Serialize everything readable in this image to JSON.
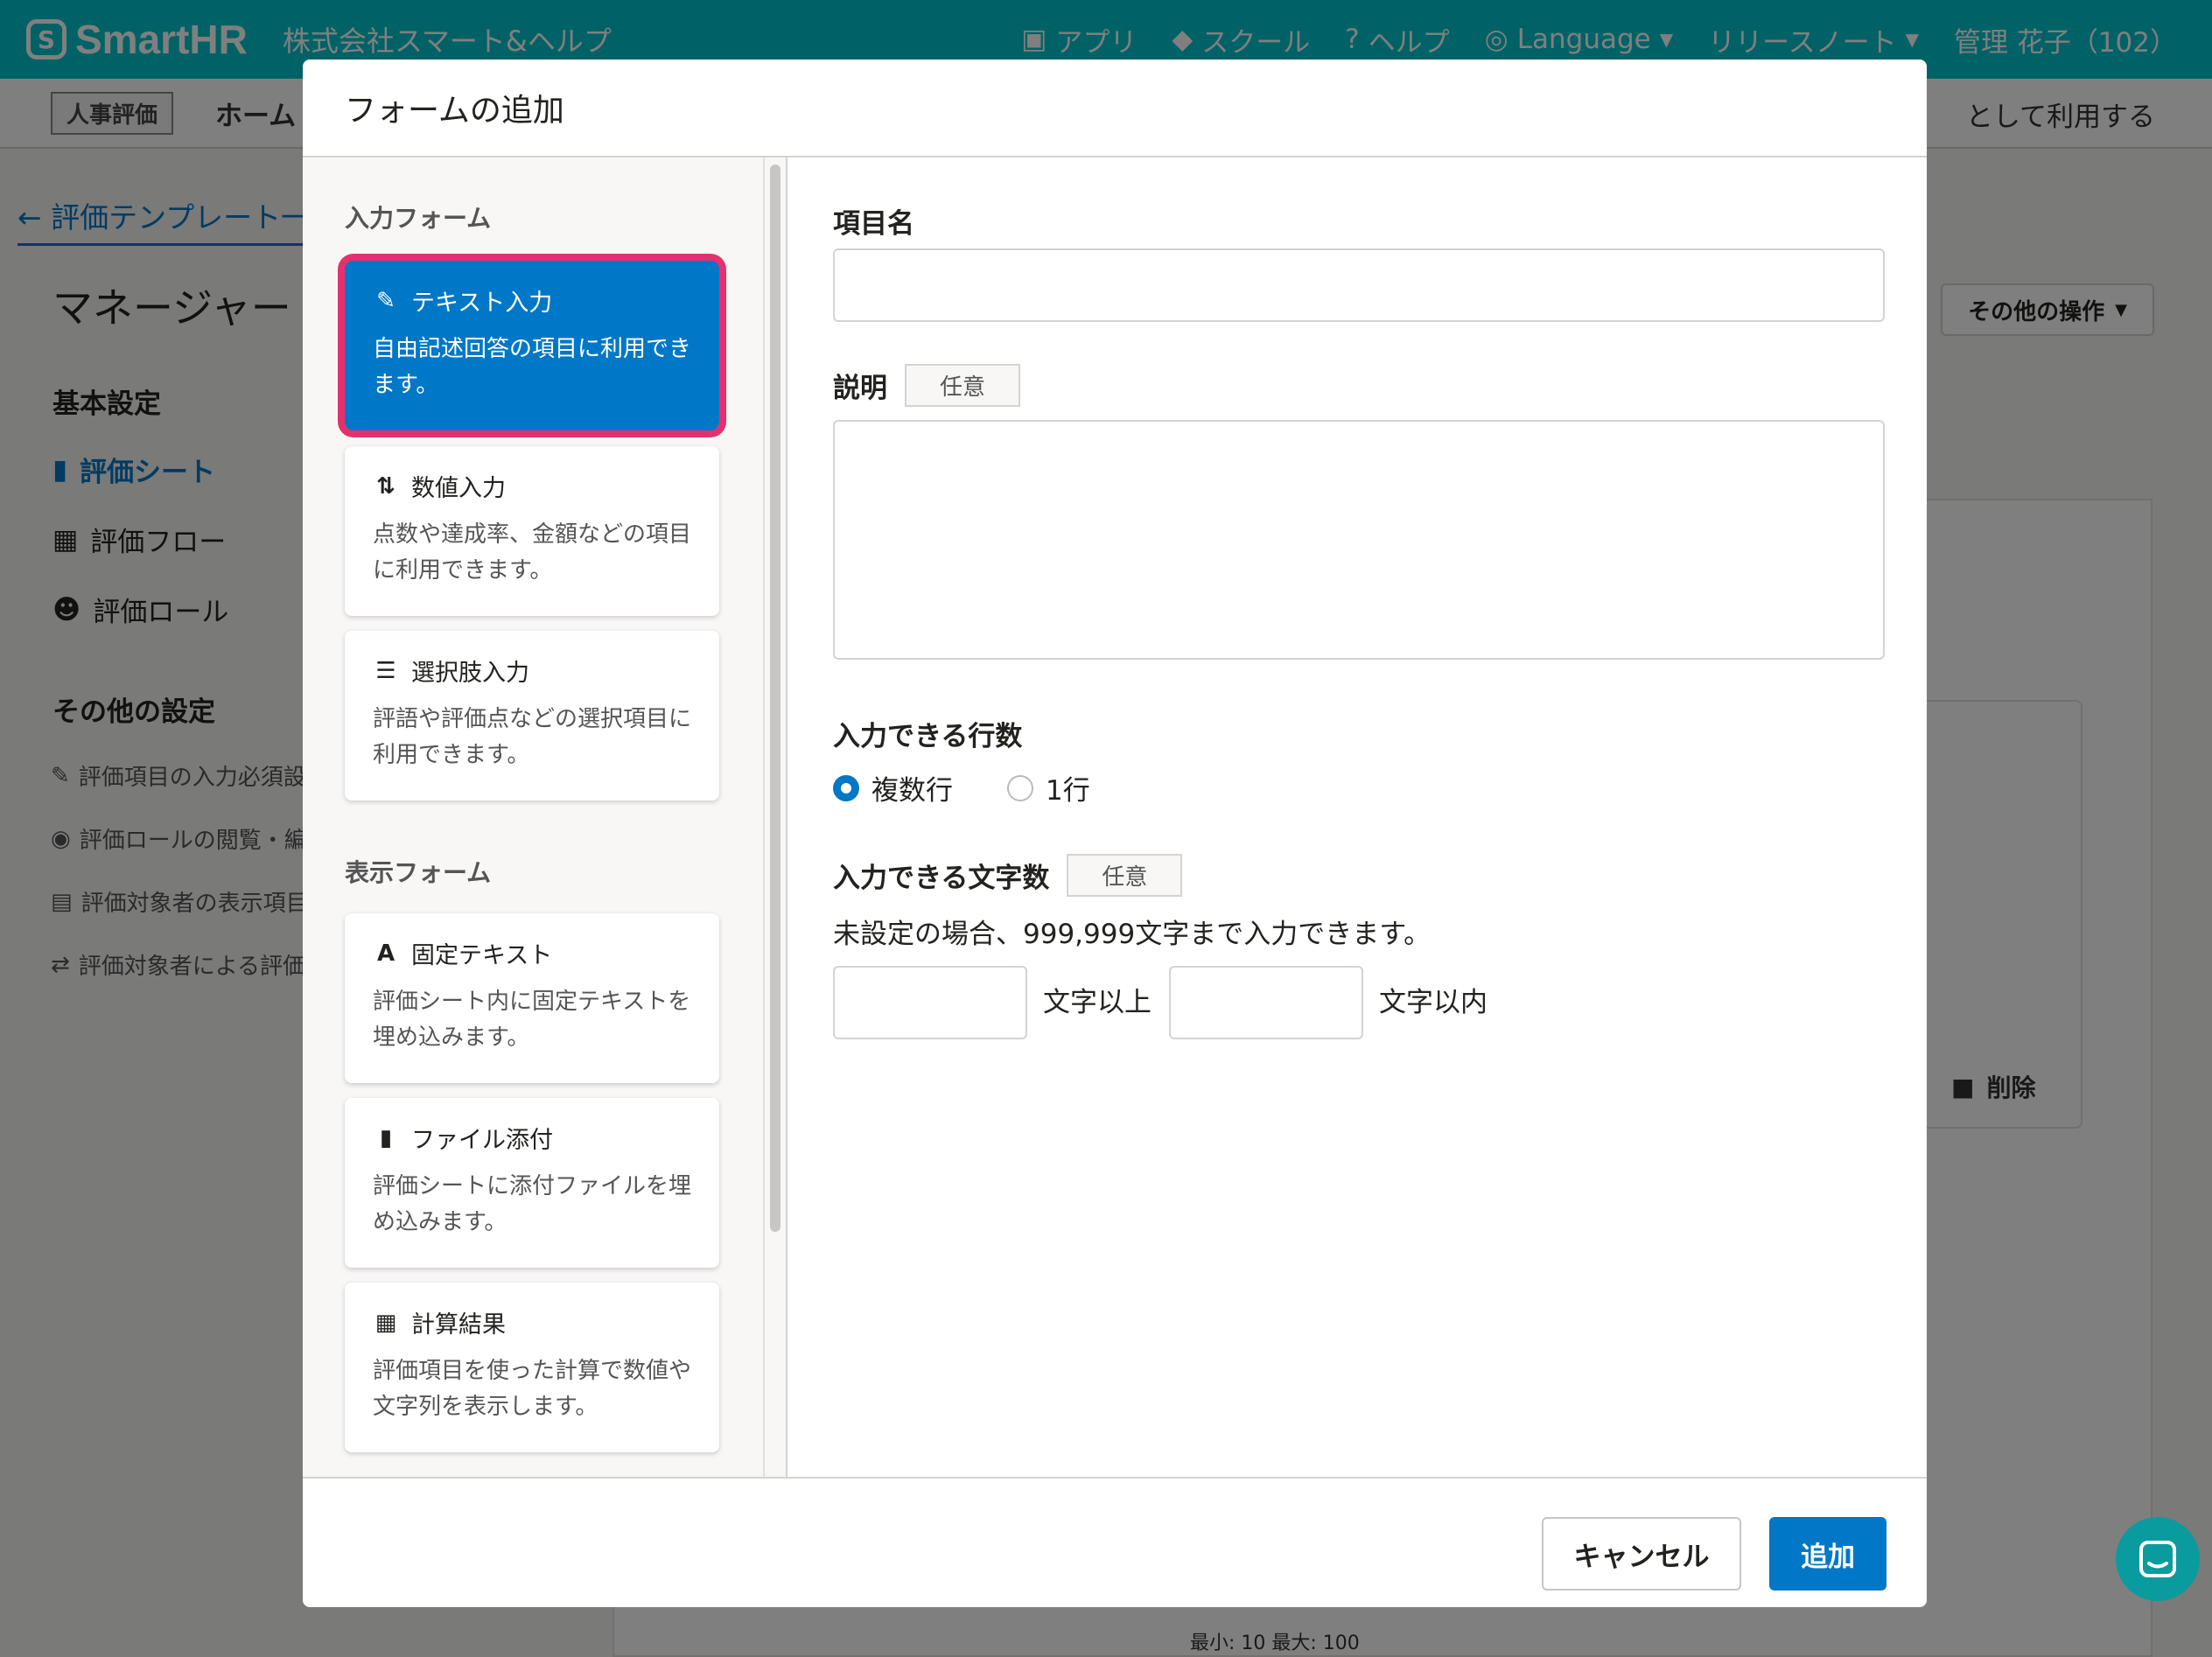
{
  "header": {
    "logo_text": "SmartHR",
    "company": "株式会社スマート&ヘルプ",
    "nav": [
      "アプリ",
      "スクール",
      "ヘルプ",
      "Language",
      "リリースノート"
    ],
    "user": "管理 花子（102）"
  },
  "subbar": {
    "app_chip": "人事評価",
    "home": "ホーム",
    "right_text": "として利用する"
  },
  "page": {
    "back_link": "評価テンプレート一覧",
    "title": "マネージャー",
    "more_actions": "その他の操作",
    "basic_settings": "基本設定",
    "nav_sheet": "評価シート",
    "nav_flow": "評価フロー",
    "nav_role": "評価ロール",
    "other_settings": "その他の設定",
    "other_items": [
      "評価項目の入力必須設定",
      "評価ロールの閲覧・編集設定",
      "評価対象者の表示項目設定",
      "評価対象者による評価"
    ],
    "bg_delete": "削除",
    "bg_bottom": "最小: 10  最大: 100"
  },
  "dialog": {
    "title": "フォームの追加",
    "input_forms_label": "入力フォーム",
    "display_forms_label": "表示フォーム",
    "input_forms": [
      {
        "title": "テキスト入力",
        "desc": "自由記述回答の項目に利用できます。",
        "icon": "pencil-icon"
      },
      {
        "title": "数値入力",
        "desc": "点数や達成率、金額などの項目に利用できます。",
        "icon": "sort-numeric-icon"
      },
      {
        "title": "選択肢入力",
        "desc": "評語や評価点などの選択項目に利用できます。",
        "icon": "list-icon"
      }
    ],
    "display_forms": [
      {
        "title": "固定テキスト",
        "desc": "評価シート内に固定テキストを埋め込みます。",
        "icon": "font-icon"
      },
      {
        "title": "ファイル添付",
        "desc": "評価シートに添付ファイルを埋め込みます。",
        "icon": "file-icon"
      },
      {
        "title": "計算結果",
        "desc": "評価項目を使った計算で数値や文字列を表示します。",
        "icon": "calculator-icon"
      }
    ],
    "field_name_label": "項目名",
    "field_name_value": "",
    "description_label": "説明",
    "optional_badge": "任意",
    "description_value": "",
    "lines_label": "入力できる行数",
    "lines_options": [
      "複数行",
      "1行"
    ],
    "lines_selected": "複数行",
    "chars_label": "入力できる文字数",
    "chars_helper": "未設定の場合、999,999文字まで入力できます。",
    "min_value": "",
    "min_suffix": "文字以上",
    "max_value": "",
    "max_suffix": "文字以内",
    "cancel_label": "キャンセル",
    "add_label": "追加"
  },
  "colors": {
    "brand": "#00c4cc",
    "primary": "#0077c7",
    "highlight": "#e6306e"
  }
}
